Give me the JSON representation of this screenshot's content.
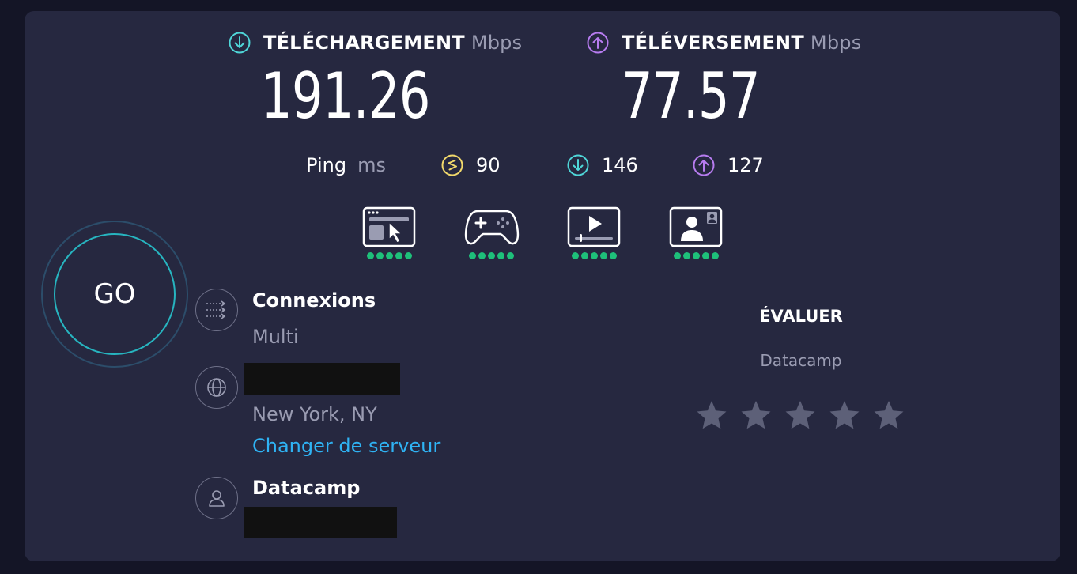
{
  "download": {
    "label": "TÉLÉCHARGEMENT",
    "unit": "Mbps",
    "value": "191.26",
    "icon": "arrow-down-circle-icon",
    "color": "#4fd6d8"
  },
  "upload": {
    "label": "TÉLÉVERSEMENT",
    "unit": "Mbps",
    "value": "77.57",
    "icon": "arrow-up-circle-icon",
    "color": "#b77cf0"
  },
  "ping": {
    "label": "Ping",
    "unit": "ms",
    "idle": {
      "value": "90",
      "icon": "idle-latency-icon",
      "color": "#f2d96b"
    },
    "download": {
      "value": "146",
      "icon": "arrow-down-circle-icon",
      "color": "#4fd6d8"
    },
    "upload": {
      "value": "127",
      "icon": "arrow-up-circle-icon",
      "color": "#b77cf0"
    }
  },
  "activities": [
    {
      "icon": "web-browsing-icon",
      "rating": 5
    },
    {
      "icon": "gaming-controller-icon",
      "rating": 5
    },
    {
      "icon": "video-streaming-icon",
      "rating": 5
    },
    {
      "icon": "video-call-icon",
      "rating": 5
    }
  ],
  "go_button": {
    "label": "GO"
  },
  "connections": {
    "title": "Connexions",
    "value": "Multi",
    "icon": "connections-icon"
  },
  "server": {
    "location": "New York, NY",
    "change_link": "Changer de serveur",
    "icon": "globe-icon"
  },
  "provider": {
    "name": "Datacamp",
    "icon": "user-icon"
  },
  "rating": {
    "title": "ÉVALUER",
    "provider": "Datacamp",
    "stars": 5,
    "star_color": "#5d6078"
  },
  "colors": {
    "background": "#141526",
    "panel": "#262840",
    "accent_link": "#2fb3f4",
    "dot_green": "#1ec07a"
  }
}
